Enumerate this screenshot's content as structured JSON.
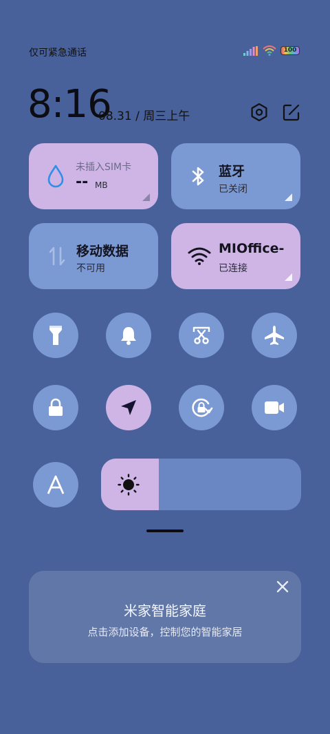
{
  "status_bar": {
    "carrier_text": "仅可紧急通话",
    "battery_level": "100"
  },
  "clock": {
    "time": "8:16",
    "date": "08.31 / 周三上午"
  },
  "tiles": {
    "data_usage": {
      "title": "未插入SIM卡",
      "value": "--",
      "unit": "MB"
    },
    "bluetooth": {
      "title": "蓝牙",
      "status": "已关闭"
    },
    "mobile_data": {
      "title": "移动数据",
      "status": "不可用"
    },
    "wifi": {
      "title": "MIOffice-",
      "status": "已连接"
    }
  },
  "toggles": [
    {
      "name": "flashlight",
      "active": false
    },
    {
      "name": "bell",
      "active": false
    },
    {
      "name": "screenshot",
      "active": false
    },
    {
      "name": "airplane",
      "active": false
    },
    {
      "name": "lock",
      "active": false
    },
    {
      "name": "location",
      "active": true
    },
    {
      "name": "auto-rotate",
      "active": false
    },
    {
      "name": "video",
      "active": false
    },
    {
      "name": "auto-brightness",
      "active": false
    }
  ],
  "brightness": {
    "level": 0.29
  },
  "smart_home_card": {
    "title": "米家智能家庭",
    "subtitle": "点击添加设备，控制您的智能家居"
  },
  "colors": {
    "background": "#48619a",
    "tile_active": "#cfb5e6",
    "tile_inactive": "#7b99d3"
  }
}
